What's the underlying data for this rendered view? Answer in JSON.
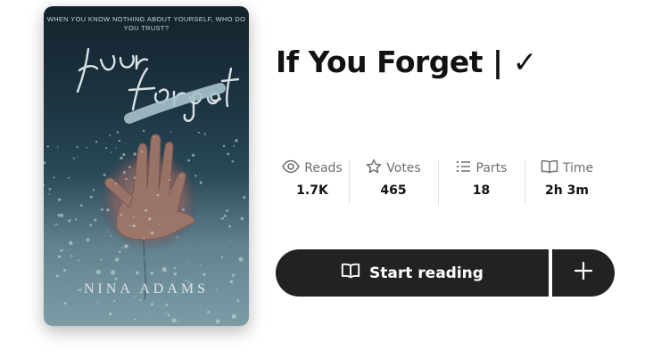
{
  "cover": {
    "tagline": "WHEN YOU KNOW NOTHING ABOUT YOURSELF, WHO DO YOU TRUST?",
    "title_script": "If you forget",
    "author": "NINA ADAMS"
  },
  "story": {
    "title": "If You Forget | ✓"
  },
  "stats": [
    {
      "icon": "eye-icon",
      "label": "Reads",
      "value": "1.7K"
    },
    {
      "icon": "star-icon",
      "label": "Votes",
      "value": "465"
    },
    {
      "icon": "list-icon",
      "label": "Parts",
      "value": "18"
    },
    {
      "icon": "book-icon",
      "label": "Time",
      "value": "2h 3m"
    }
  ],
  "actions": {
    "start_reading_label": "Start reading",
    "start_reading_icon": "book-open-icon",
    "add_icon": "plus-icon"
  },
  "colors": {
    "button_bg": "#222222",
    "text_primary": "#121212",
    "text_muted": "#6f6f6f"
  }
}
